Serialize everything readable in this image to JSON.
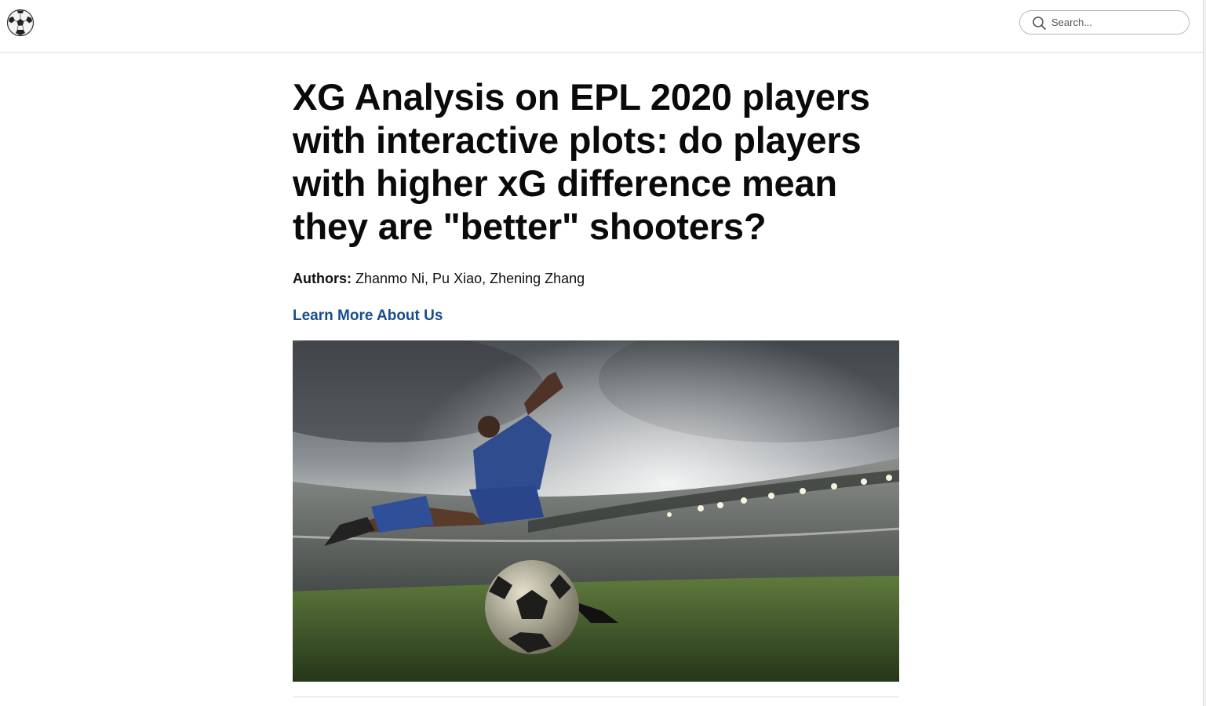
{
  "header": {
    "logo_icon": "soccer-ball-icon",
    "search": {
      "placeholder": "Search...",
      "value": "",
      "icon": "search-icon"
    }
  },
  "article": {
    "title": "XG Analysis on EPL 2020 players with interactive plots: do players with higher xG difference mean they are \"better\" shooters?",
    "authors_label": "Authors:",
    "authors": "Zhanmo Ni, Pu Xiao, Zhening Zhang",
    "learn_more_link": "Learn More About Us",
    "hero_image": "soccer-player-kicking-ball-in-stadium"
  },
  "colors": {
    "link": "#174d8c",
    "text": "#0a0a0a",
    "border": "#e2e2e2"
  }
}
